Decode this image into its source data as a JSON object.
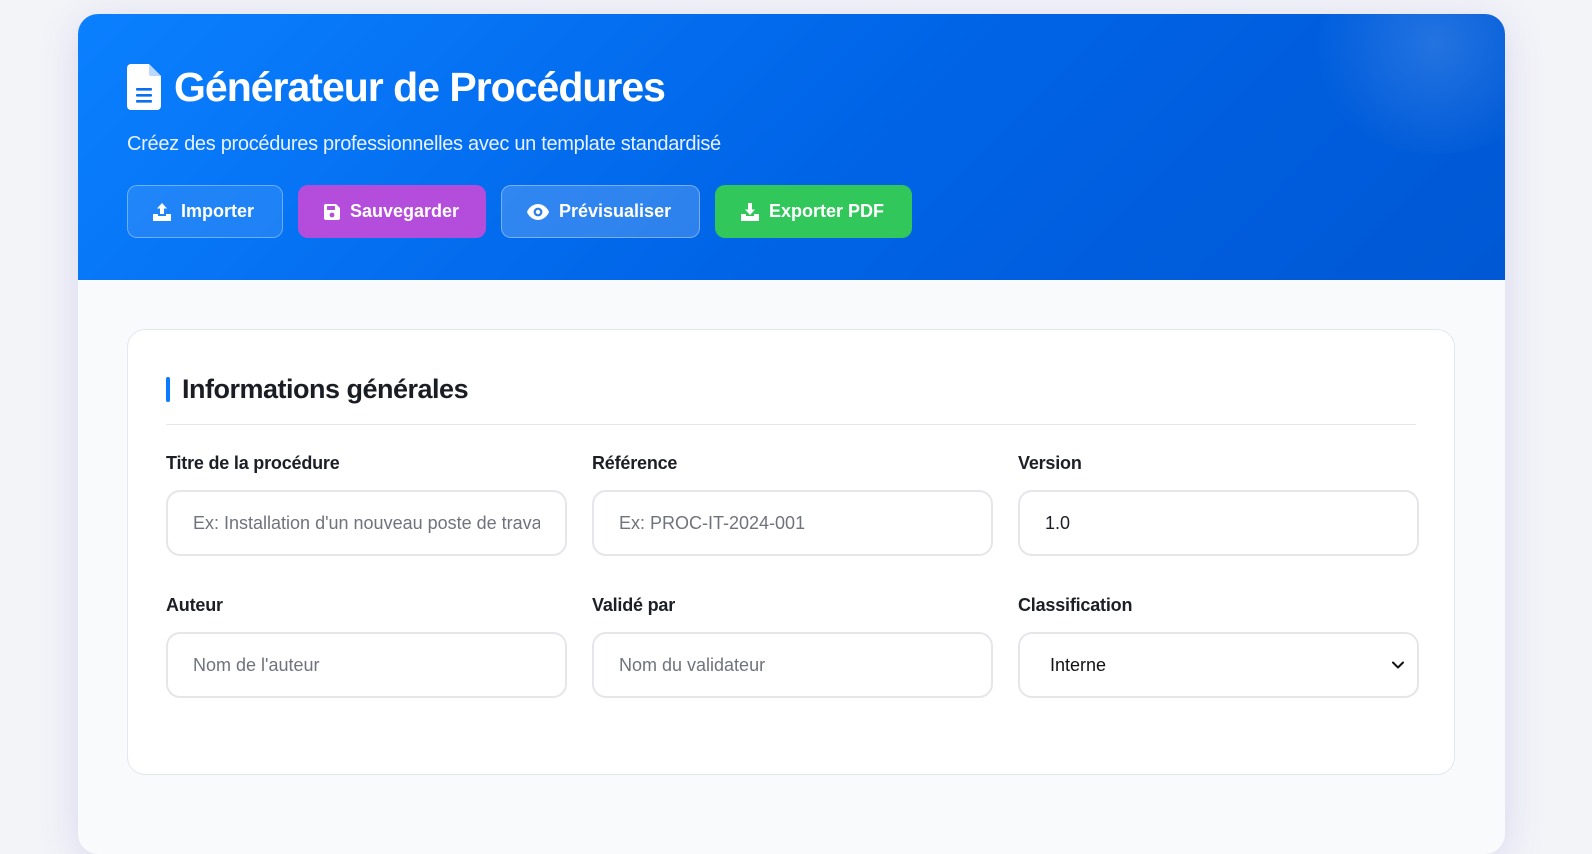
{
  "header": {
    "title": "Générateur de Procédures",
    "subtitle": "Créez des procédures professionnelles avec un template standardisé",
    "icon": "document-icon",
    "buttons": {
      "import": "Importer",
      "save": "Sauvegarder",
      "preview": "Prévisualiser",
      "export": "Exporter PDF"
    }
  },
  "section": {
    "title": "Informations générales",
    "fields": {
      "title": {
        "label": "Titre de la procédure",
        "placeholder": "Ex: Installation d'un nouveau poste de travail",
        "value": ""
      },
      "reference": {
        "label": "Référence",
        "placeholder": "Ex: PROC-IT-2024-001",
        "value": ""
      },
      "version": {
        "label": "Version",
        "placeholder": "",
        "value": "1.0"
      },
      "author": {
        "label": "Auteur",
        "placeholder": "Nom de l'auteur",
        "value": ""
      },
      "validator": {
        "label": "Validé par",
        "placeholder": "Nom du validateur",
        "value": ""
      },
      "classification": {
        "label": "Classification",
        "selected": "Interne"
      }
    }
  },
  "colors": {
    "header_start": "#0a80ff",
    "header_end": "#0058d4",
    "save_button": "#b44ddb",
    "export_button": "#31c75a",
    "accent": "#0a7aff"
  }
}
